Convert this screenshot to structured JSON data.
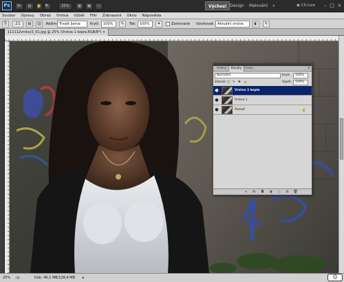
{
  "appbar": {
    "logo": "Ps",
    "zoom": "25%",
    "workspaces": [
      "Výchozí",
      "Design",
      "Malování"
    ],
    "more": "»",
    "cs_live": "CS Live",
    "window_controls": [
      "–",
      "□",
      "×"
    ]
  },
  "menu": [
    "Soubor",
    "Úpravy",
    "Obraz",
    "Vrstva",
    "Výběr",
    "Filtr",
    "Zobrazení",
    "Okno",
    "Nápověda"
  ],
  "options": {
    "mode_label": "Režim:",
    "mode_value": "Trvalé barva",
    "opacity_label": "Krytí:",
    "opacity_value": "100%",
    "flow_label": "Tok:",
    "flow_value": "100%",
    "align_label": "Zarovnané",
    "sample_label": "Vzorkovat:",
    "sample_value": "Aktuální vrstva",
    "brush_size": "21"
  },
  "document": {
    "tab_title": "111112vrstvy3_01.jpg @ 25% (Vrstva 1 kopie,RGB/8*) ×"
  },
  "status": {
    "zoom": "25%",
    "doc_info": "Dok: 46,1 MB/128,4 MB"
  },
  "layers_panel": {
    "tabs": [
      "Vrstvy",
      "Kanály",
      "Cesty"
    ],
    "blend_mode": "Normální",
    "opacity_label": "Krytí:",
    "opacity_value": "100%",
    "lock_label": "Zámek:",
    "fill_label": "Výplň:",
    "fill_value": "100%",
    "layers": [
      {
        "name": "Vrstva 1 kopie",
        "selected": true
      },
      {
        "name": "Vrstva 1",
        "selected": false
      },
      {
        "name": "Pozadí",
        "selected": false,
        "locked": true
      }
    ]
  },
  "badge": "☺"
}
